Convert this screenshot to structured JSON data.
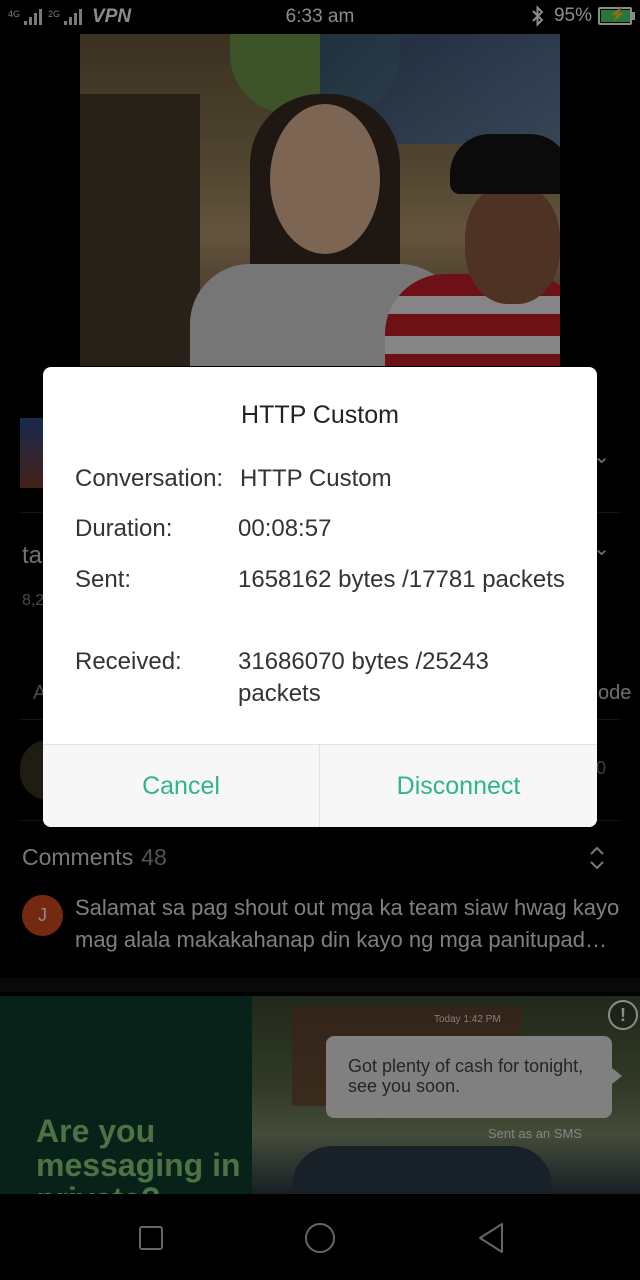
{
  "status_bar": {
    "network_1": "4G",
    "network_2": "2G",
    "vpn": "VPN",
    "time": "6:33 am",
    "battery": "95%",
    "battery_level": 0.95
  },
  "background": {
    "frag_title": "ta",
    "frag_views": "8,2",
    "frag_left": "A",
    "frag_right": "ode",
    "frag_zero": "0"
  },
  "comments": {
    "header": "Comments",
    "count": "48",
    "first": {
      "avatar_letter": "J",
      "text": "Salamat sa pag shout out mga ka team siaw hwag kayo mag alala makakahanap din kayo ng mga panitupad mga kaibigan salamat po sa inyong suporta"
    }
  },
  "ad": {
    "headline": "Are you messaging in private?",
    "time": "Today 1:42 PM",
    "bubble": "Got plenty of cash for tonight, see you soon.",
    "sms_label": "Sent as an SMS",
    "info": "!"
  },
  "dialog": {
    "title": "HTTP Custom",
    "rows": [
      {
        "label": "Conversation:",
        "value": "HTTP Custom"
      },
      {
        "label": "Duration:",
        "value": "00:08:57"
      },
      {
        "label": "Sent:",
        "value": "1658162 bytes /17781 packets"
      },
      {
        "label": "Received:",
        "value": "31686070 bytes /25243 packets"
      }
    ],
    "cancel": "Cancel",
    "disconnect": "Disconnect",
    "accent_color": "#2fb48b"
  },
  "icons": [
    "bluetooth-icon",
    "battery-icon",
    "signal-icon",
    "sort-icon",
    "chevron-down-icon",
    "info-icon",
    "nav-recents-icon",
    "nav-home-icon",
    "nav-back-icon"
  ]
}
